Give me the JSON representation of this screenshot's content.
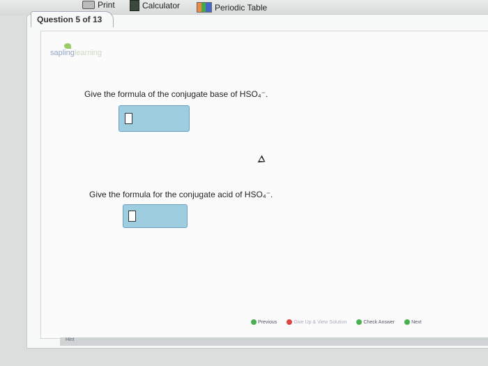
{
  "toolbar": {
    "print_label": "Print",
    "calculator_label": "Calculator",
    "periodic_table_label": "Periodic Table"
  },
  "question_tab": "Question 5 of 13",
  "logo": {
    "text_part1": "sapling",
    "text_part2": "learning"
  },
  "questions": [
    {
      "text": "Give the formula of the conjugate base of HSO₄⁻."
    },
    {
      "text": "Give the formula for the conjugate acid of HSO₄⁻."
    }
  ],
  "nav": {
    "previous": "Previous",
    "give_up": "Give Up & View Solution",
    "check_answer": "Check Answer",
    "next": "Next"
  },
  "hint_label": "Hint",
  "colors": {
    "answer_box": "#9fcde0",
    "answer_border": "#6a9fbf"
  }
}
